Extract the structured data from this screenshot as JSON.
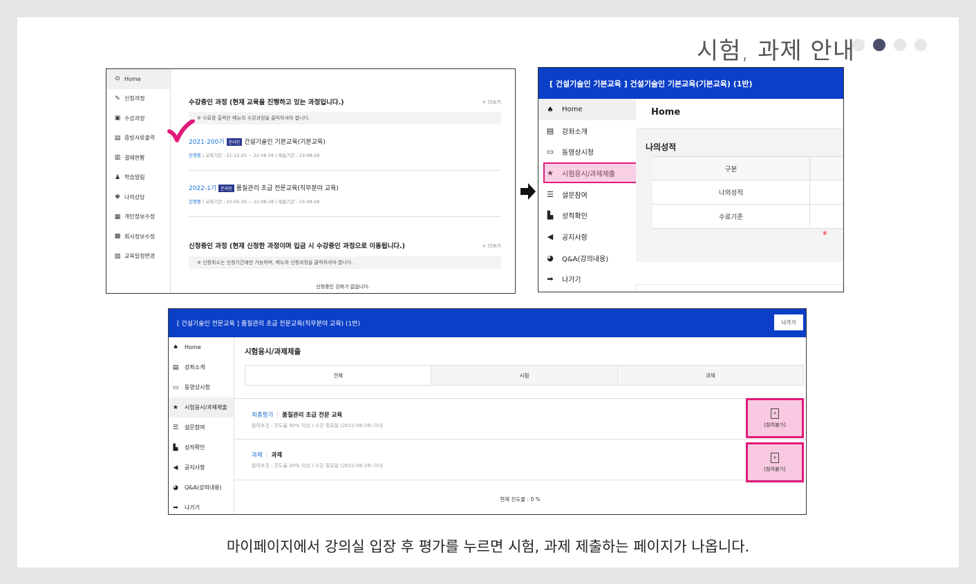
{
  "header": {
    "title": "시험, 과제 안내",
    "dots_total": 4,
    "dots_active_index": 1
  },
  "caption": "마이페이지에서 강의실 입장 후 평가를 누르면 시험, 과제 제출하는 페이지가 나옵니다.",
  "screen1": {
    "sidebar": [
      {
        "icon": "home-icon",
        "glyph": "⊙",
        "label": "Home"
      },
      {
        "icon": "pencil-icon",
        "glyph": "✎",
        "label": "신청과정"
      },
      {
        "icon": "book-icon",
        "glyph": "▣",
        "label": "수강과정"
      },
      {
        "icon": "certificate-icon",
        "glyph": "▤",
        "label": "증빙서류출력"
      },
      {
        "icon": "receipt-icon",
        "glyph": "▥",
        "label": "결제현황"
      },
      {
        "icon": "bell-icon",
        "glyph": "♟",
        "label": "학습알림"
      },
      {
        "icon": "people-icon",
        "glyph": "♚",
        "label": "나의상담"
      },
      {
        "icon": "profile-icon",
        "glyph": "▦",
        "label": "개인정보수정"
      },
      {
        "icon": "company-icon",
        "glyph": "▩",
        "label": "회사정보수정"
      },
      {
        "icon": "schedule-icon",
        "glyph": "▨",
        "label": "교육일정변경"
      }
    ],
    "section1_title": "수강중인 과정 (현재 교육을 진행하고 있는 과정입니다.)",
    "more_label": "+ 더보기",
    "notice1": "※ 수료증 출력은 메뉴의 수강과정을 클릭하셔야 합니다.",
    "courses": [
      {
        "gen": "2021-200기",
        "badge": "온라인",
        "name": "건설기술인 기본교육(기본교육)",
        "status": "진행중",
        "meta": "교육기간 : 21-12-25 ~ 22-08-28",
        "review": "복습기간 : 23-08-28"
      },
      {
        "gen": "2022-1기",
        "badge": "온라인",
        "name": "품질관리 초급 전문교육(직무분야 교육)",
        "status": "진행중",
        "meta": "교육기간 : 22-05-30 ~ 22-08-28",
        "review": "복습기간 : 23-08-28"
      }
    ],
    "section2_title": "신청중인 과정 (현재 신청한 과정이며 입금 시 수강중인 과정으로 이동됩니다.)",
    "notice2": "※ 신청취소는 신청기간에만 가능하며, 메뉴의 신청과정을 클릭하셔야 합니다.",
    "empty_text": "신청중인 강좌가 없습니다."
  },
  "screen2": {
    "header": "[ 건설기술인 기본교육 ] 건설기술인 기본교육(기본교육) (1반)",
    "sidebar": [
      {
        "icon": "home-icon",
        "glyph": "♠",
        "label": "Home"
      },
      {
        "icon": "book-icon",
        "glyph": "▤",
        "label": "강좌소개"
      },
      {
        "icon": "monitor-icon",
        "glyph": "▭",
        "label": "동영상시청"
      },
      {
        "icon": "star-icon",
        "glyph": "★",
        "label": "시험응시/과제제출"
      },
      {
        "icon": "list-icon",
        "glyph": "☰",
        "label": "설문참여"
      },
      {
        "icon": "chart-icon",
        "glyph": "▙",
        "label": "성적확인"
      },
      {
        "icon": "megaphone-icon",
        "glyph": "◀",
        "label": "공지사항"
      },
      {
        "icon": "chat-icon",
        "glyph": "◕",
        "label": "Q&A(강의내용)"
      },
      {
        "icon": "exit-icon",
        "glyph": "➡",
        "label": "나가기"
      }
    ],
    "main_title": "Home",
    "panel_title": "나의성적",
    "table": {
      "header": "구분",
      "rows": [
        "나의성적",
        "수료기준"
      ]
    },
    "red_mark": "※"
  },
  "screen3": {
    "header": "[ 건설기술인 전문교육 ] 품질관리 초급 전문교육(직무분야 교육) (1반)",
    "exit_label": "나가기",
    "sidebar": [
      {
        "icon": "home-icon",
        "glyph": "♠",
        "label": "Home"
      },
      {
        "icon": "book-icon",
        "glyph": "▤",
        "label": "강좌소개"
      },
      {
        "icon": "monitor-icon",
        "glyph": "▭",
        "label": "동영상시청"
      },
      {
        "icon": "star-icon",
        "glyph": "★",
        "label": "시험응시/과제제출"
      },
      {
        "icon": "list-icon",
        "glyph": "☰",
        "label": "설문참여"
      },
      {
        "icon": "chart-icon",
        "glyph": "▙",
        "label": "성적확인"
      },
      {
        "icon": "megaphone-icon",
        "glyph": "◀",
        "label": "공지사항"
      },
      {
        "icon": "chat-icon",
        "glyph": "◕",
        "label": "Q&A(강의내용)"
      },
      {
        "icon": "exit-icon",
        "glyph": "➡",
        "label": "나가기"
      }
    ],
    "title": "시험응시/과제제출",
    "tabs": [
      "전체",
      "시험",
      "과제"
    ],
    "entries": [
      {
        "category": "최종평가",
        "name": "품질관리 초급 전문 교육",
        "condition": "참여조건 : 진도율 90% 이상 / 수강 종료일 (2022-08-28) 이내",
        "button": "[참여불가]"
      },
      {
        "category": "과제",
        "name": "과제",
        "condition": "참여조건 : 진도율 20% 이상 / 수강 종료일 (2022-08-28) 이내",
        "button": "[참여불가]"
      }
    ],
    "progress": "현재 진도율 : 0 %"
  }
}
